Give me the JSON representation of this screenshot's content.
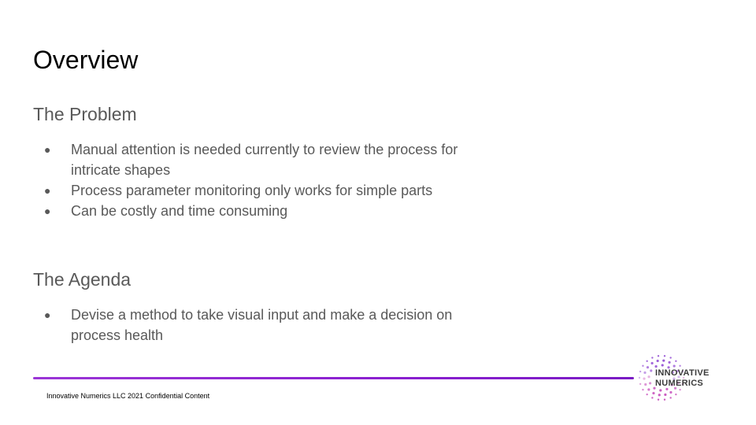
{
  "slide": {
    "title": "Overview",
    "sections": [
      {
        "heading": "The Problem",
        "bullets": [
          "Manual attention is needed currently to review the process for intricate shapes",
          "Process parameter monitoring only works for simple parts",
          "Can be costly and time consuming"
        ]
      },
      {
        "heading": "The Agenda",
        "bullets": [
          "Devise a method to take visual input and make a decision on process health"
        ]
      }
    ],
    "bullet_glyph": "●",
    "footer": "Innovative Numerics LLC 2021 Confidential Content"
  },
  "logo": {
    "line1": "INNOVATIVE",
    "line2": "NUMERICS"
  },
  "colors": {
    "accent": "#8a1fd0",
    "body_text": "#595959",
    "title_text": "#000000"
  }
}
